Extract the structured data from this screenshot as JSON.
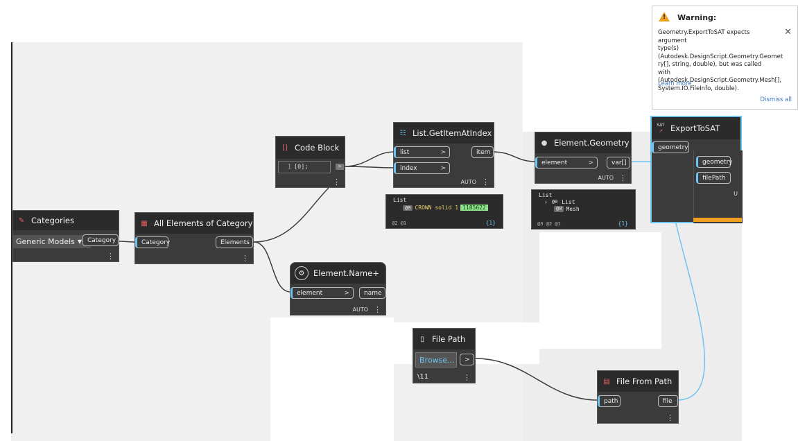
{
  "nodes": {
    "categories": {
      "title": "Categories",
      "dropdown": "Generic Models",
      "output": "Category"
    },
    "all_elements": {
      "title": "All Elements of Category",
      "input": "Category",
      "output": "Elements"
    },
    "code_block": {
      "title": "Code Block",
      "line_no": "1",
      "code": "[0];"
    },
    "get_item": {
      "title": "List.GetItemAtIndex",
      "input1": "list",
      "input2": "index",
      "output": "item",
      "lacing": "AUTO"
    },
    "element_name": {
      "title": "Element.Name+",
      "input": "element",
      "output": "name",
      "lacing": "AUTO"
    },
    "element_geometry": {
      "title": "Element.Geometry",
      "input": "element",
      "output": "var[]",
      "lacing": "AUTO"
    },
    "export_sat": {
      "title": "ExportToSAT",
      "badge": "SAT",
      "input1": "geometry",
      "input2": "geometry",
      "input3": "filePath",
      "partial_text": "U"
    },
    "file_path": {
      "title": "File Path",
      "button": "Browse...",
      "value": "\\11"
    },
    "file_from_path": {
      "title": "File From Path",
      "input": "path",
      "output": "file"
    }
  },
  "previews": {
    "get_item": {
      "header": "List",
      "tag": "@0",
      "text": "CROWN solid 1",
      "id": "1185622",
      "levels": "@2 @1",
      "count": "{1}"
    },
    "geometry": {
      "header": "List",
      "sub": "List",
      "tag": "@0",
      "text": "Mesh",
      "levels": "@3 @2 @1",
      "count": "{1}"
    }
  },
  "warning": {
    "title": "Warning:",
    "lines": [
      "Geometry.ExportToSAT expects argument",
      "type(s)",
      "(Autodesk.DesignScript.Geometry.Geomet",
      "ry[], string, double), but was called with",
      "(Autodesk.DesignScript.Geometry.Mesh[],",
      "System.IO.FileInfo, double)."
    ],
    "learn_more": "Learn more",
    "dismiss_all": "Dismiss all"
  },
  "colors": {
    "wire": "#3c3c3c",
    "wire_blue": "#6ec3f0",
    "node_body": "#3b3b3b",
    "node_header": "#2b2b2b",
    "warning_icon": "#f0a020",
    "link": "#3a78c2"
  },
  "icons": {
    "menu": "three-dots-vertical-icon",
    "dropdown": "chevron-down-icon",
    "warning": "warning-triangle-icon",
    "close": "close-x-icon"
  }
}
